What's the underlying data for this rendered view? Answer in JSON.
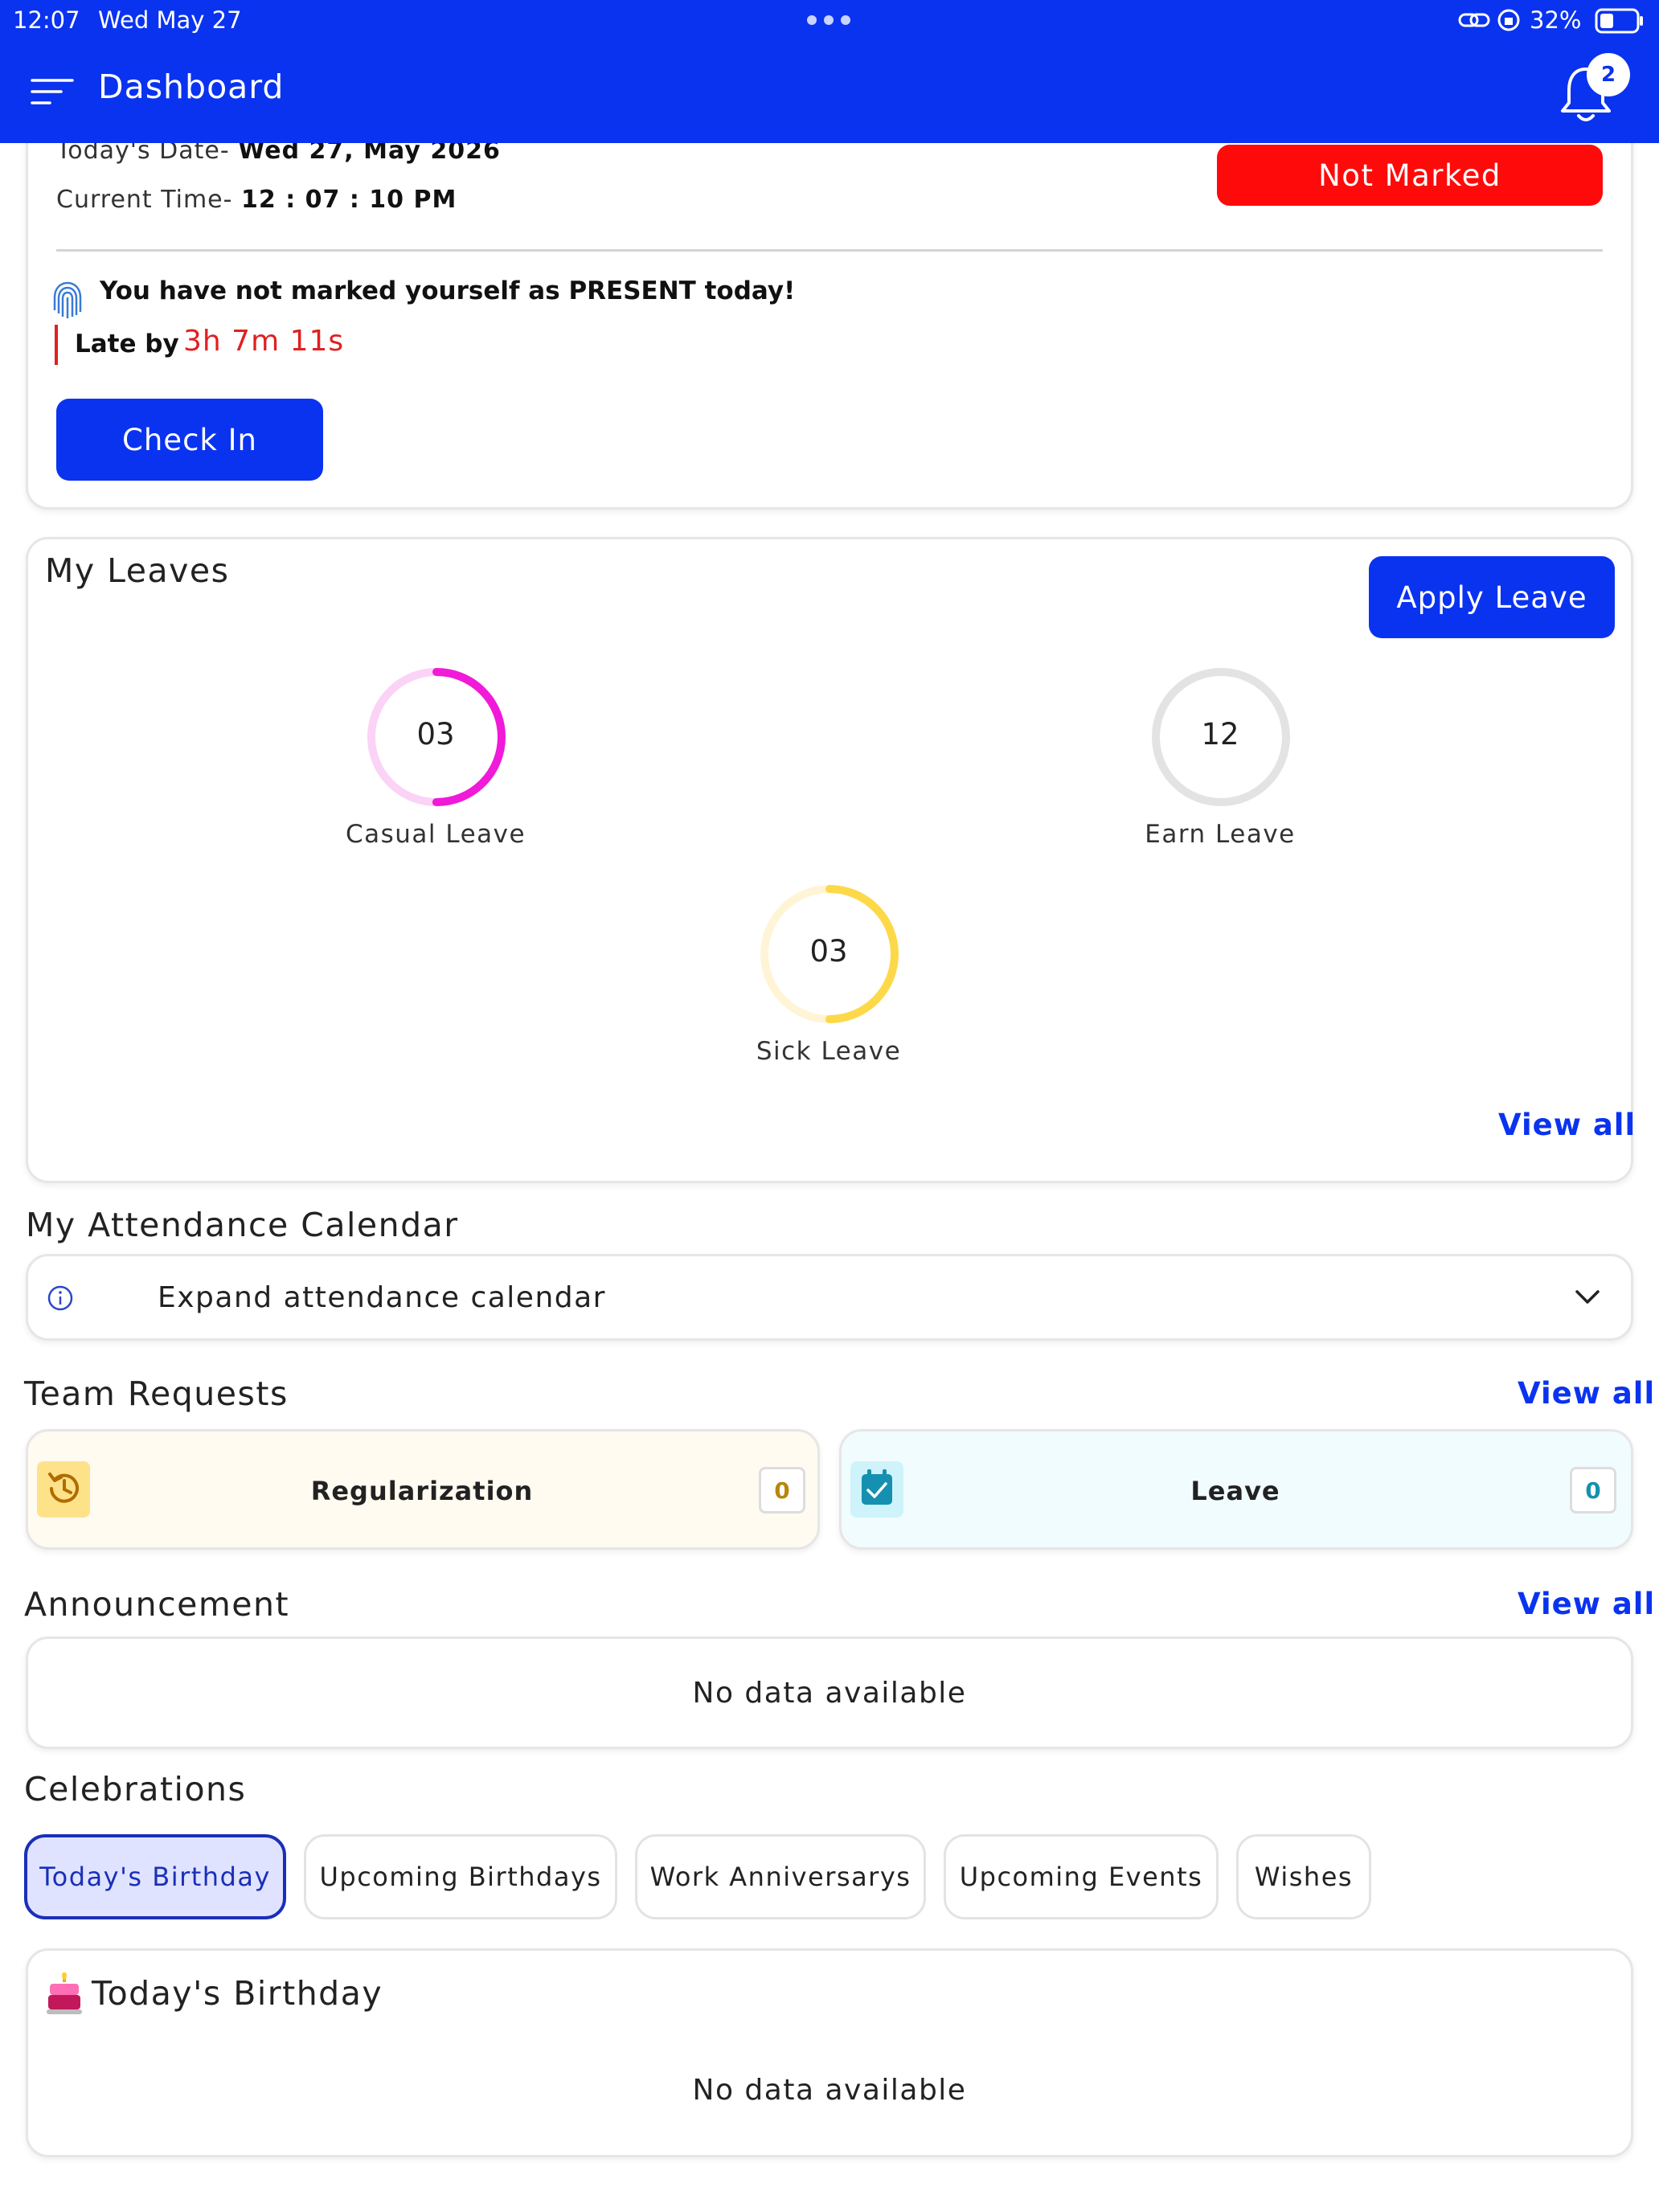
{
  "status_bar": {
    "time": "12:07",
    "date": "Wed May 27",
    "battery": "32%"
  },
  "header": {
    "title": "Dashboard",
    "notification_count": "2"
  },
  "attendance": {
    "date_label": "Today's Date-",
    "date_value": "Wed 27, May 2026",
    "time_label": "Current Time-",
    "time_value": "12 : 07 : 10 PM",
    "status": "Not Marked",
    "status_color": "#ff0a0a",
    "message": "You have not marked yourself as PRESENT today!",
    "late_label": "Late by",
    "late_value": "3h 7m 11s",
    "check_in_label": "Check In"
  },
  "leaves": {
    "title": "My Leaves",
    "apply_label": "Apply Leave",
    "view_all": "View all",
    "items": [
      {
        "value": "03",
        "label": "Casual Leave",
        "color": "#f01ad8",
        "fraction": 0.5
      },
      {
        "value": "12",
        "label": "Earn Leave",
        "color": "#d9d9d9",
        "fraction": 0
      },
      {
        "value": "03",
        "label": "Sick Leave",
        "color": "#fdd94a",
        "fraction": 0.5
      }
    ]
  },
  "attendance_calendar": {
    "title": "My Attendance Calendar",
    "expand_label": "Expand attendance calendar"
  },
  "team_requests": {
    "title": "Team Requests",
    "view_all": "View all",
    "items": [
      {
        "label": "Regularization",
        "count": "0"
      },
      {
        "label": "Leave",
        "count": "0"
      }
    ]
  },
  "announcement": {
    "title": "Announcement",
    "view_all": "View all",
    "empty": "No data available"
  },
  "celebrations": {
    "title": "Celebrations",
    "tabs": [
      "Today's Birthday",
      "Upcoming Birthdays",
      "Work Anniversarys",
      "Upcoming Events",
      "Wishes"
    ],
    "panel_title": "Today's Birthday",
    "empty": "No data available"
  }
}
